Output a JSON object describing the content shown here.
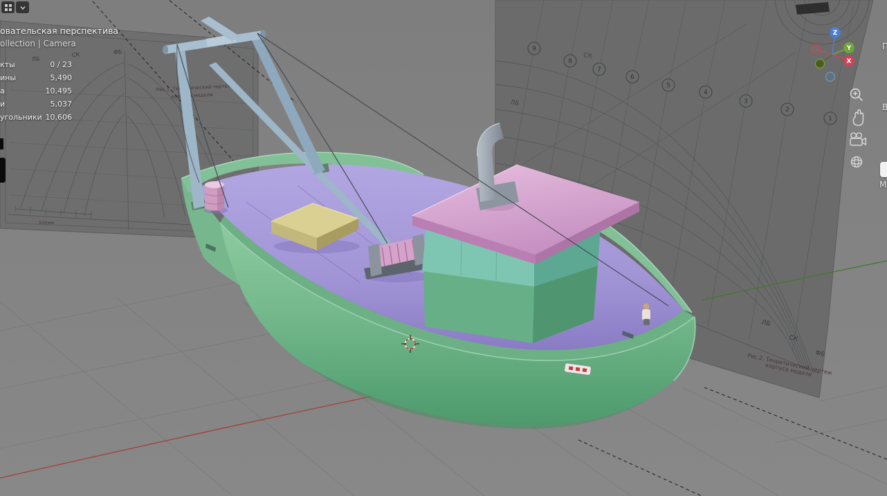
{
  "header": {
    "view_label": "овательская перспектива",
    "breadcrumb": "ollection | Camera"
  },
  "stats": {
    "rows": [
      {
        "label": "кты",
        "value": "0 / 23"
      },
      {
        "label": "ины",
        "value": "5,490"
      },
      {
        "label": "а",
        "value": "10,495"
      },
      {
        "label": "и",
        "value": "5,037"
      },
      {
        "label": "угольники",
        "value": "10,606"
      }
    ]
  },
  "gizmo": {
    "x": "X",
    "y": "Y",
    "z": "Z"
  },
  "edge_labels": {
    "top": "П",
    "mid": "В",
    "bottom": "М"
  },
  "blueprints": {
    "stations": [
      "9",
      "8",
      "7",
      "6",
      "5",
      "4",
      "3",
      "2",
      "1"
    ],
    "left": {
      "axis1": "ЛБ",
      "axis2": "СК",
      "axis3": "ФБ",
      "caption1": "Рис.1. Теоретический чертеж",
      "caption2": "корпуса модели",
      "scale": "500мм"
    },
    "right": {
      "axis1": "ЛБ",
      "axis2": "СК",
      "axis3": "ФБ",
      "caption1": "Рис.2. Теоретический чертеж",
      "caption2": "корпуса модели"
    }
  },
  "colors": {
    "hull_green": "#7fc095",
    "deck_purple": "#a79ad8",
    "cabin_teal": "#7fc6b2",
    "roof_pink": "#d9aed3",
    "axis_x": "#cc4455",
    "axis_y": "#71a33e",
    "axis_z": "#4a7fd0"
  }
}
